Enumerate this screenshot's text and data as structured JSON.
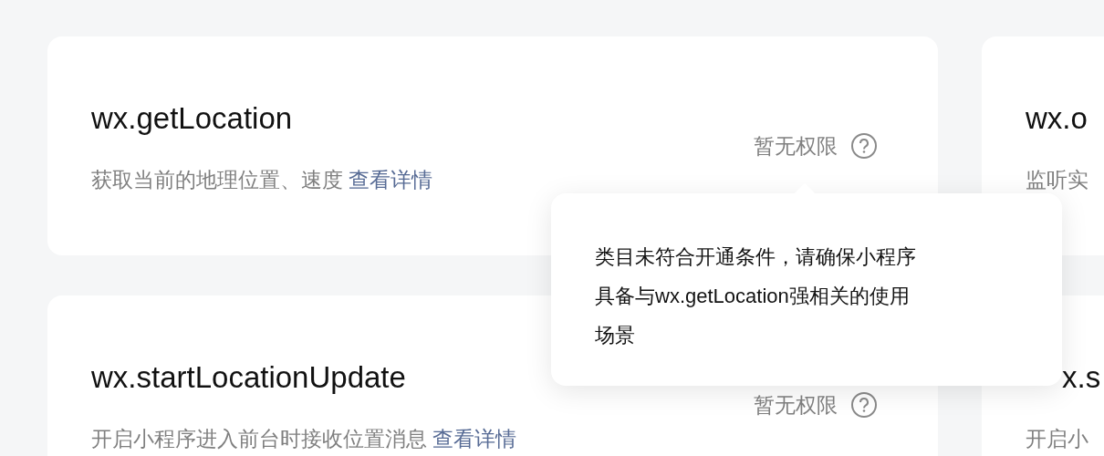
{
  "cards": [
    {
      "title": "wx.getLocation",
      "description": "获取当前的地理位置、速度",
      "link": "查看详情",
      "status": "暂无权限"
    },
    {
      "title": "wx.o",
      "description": "监听实"
    },
    {
      "title": "wx.startLocationUpdate",
      "description": "开启小程序进入前台时接收位置消息",
      "link": "查看详情",
      "status": "暂无权限"
    },
    {
      "title": "x.s",
      "description": "开启小"
    }
  ],
  "tooltip": {
    "text": "类目未符合开通条件，请确保小程序具备与wx.getLocation强相关的使用场景"
  }
}
